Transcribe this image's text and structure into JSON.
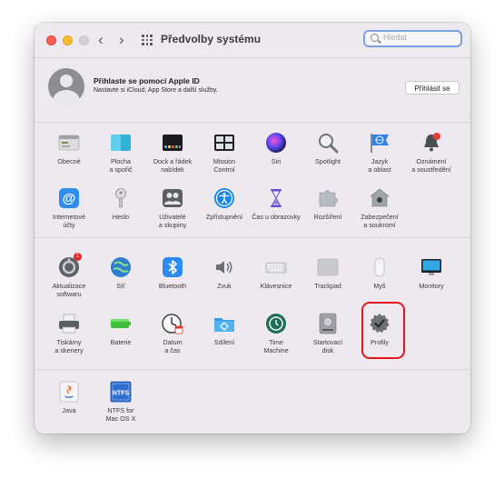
{
  "window": {
    "title": "Předvolby systému",
    "back_glyph": "‹",
    "forward_glyph": "›",
    "search_placeholder": "Hledat"
  },
  "apple_id": {
    "title": "Přihlaste se pomocí Apple ID",
    "subtitle": "Nastavte si iCloud, App Store a další služby.",
    "button": "Přihlásit se"
  },
  "colors": {
    "accent": "#3a83f6",
    "window_bg": "#ede9ef",
    "highlight_border": "#e4171f"
  },
  "sections": {
    "personal": [
      {
        "label": "Obecné",
        "icon": "general-icon"
      },
      {
        "label": "Plocha\na spořič",
        "icon": "desktop-screensaver-icon"
      },
      {
        "label": "Dock a řádek\nnabídek",
        "icon": "dock-menubar-icon"
      },
      {
        "label": "Mission\nControl",
        "icon": "mission-control-icon"
      },
      {
        "label": "Siri",
        "icon": "siri-icon"
      },
      {
        "label": "Spotlight",
        "icon": "spotlight-icon"
      },
      {
        "label": "Jazyk\na oblast",
        "icon": "language-region-icon"
      },
      {
        "label": "Oznámení\na soustředění",
        "icon": "notifications-icon"
      },
      {
        "label": "Internetové\núčty",
        "icon": "internet-accounts-icon"
      },
      {
        "label": "Heslo",
        "icon": "password-icon"
      },
      {
        "label": "Uživatelé\na skupiny",
        "icon": "users-groups-icon"
      },
      {
        "label": "Zpřístupnění",
        "icon": "accessibility-icon"
      },
      {
        "label": "Čas u obrazovky",
        "icon": "screen-time-icon"
      },
      {
        "label": "Rozšíření",
        "icon": "extensions-icon"
      },
      {
        "label": "Zabezpečení\na soukromí",
        "icon": "security-privacy-icon"
      }
    ],
    "hardware": [
      {
        "label": "Aktualizace\nsoftwaru",
        "icon": "software-update-icon",
        "badge": "1"
      },
      {
        "label": "Síť",
        "icon": "network-icon"
      },
      {
        "label": "Bluetooth",
        "icon": "bluetooth-icon"
      },
      {
        "label": "Zvuk",
        "icon": "sound-icon"
      },
      {
        "label": "Klávesnice",
        "icon": "keyboard-icon"
      },
      {
        "label": "Trackpad",
        "icon": "trackpad-icon"
      },
      {
        "label": "Myš",
        "icon": "mouse-icon"
      },
      {
        "label": "Monitory",
        "icon": "displays-icon"
      },
      {
        "label": "Tiskárny\na skenery",
        "icon": "printers-scanners-icon"
      },
      {
        "label": "Baterie",
        "icon": "battery-icon"
      },
      {
        "label": "Datum\na čas",
        "icon": "date-time-icon"
      },
      {
        "label": "Sdílení",
        "icon": "sharing-icon"
      },
      {
        "label": "Time\nMachine",
        "icon": "time-machine-icon"
      },
      {
        "label": "Startovací\ndisk",
        "icon": "startup-disk-icon"
      },
      {
        "label": "Profily",
        "icon": "profiles-icon"
      }
    ],
    "other": [
      {
        "label": "Java",
        "icon": "java-icon"
      },
      {
        "label": "NTFS for\nMac OS X",
        "icon": "ntfs-icon",
        "icon_text": "NTFS"
      }
    ]
  }
}
